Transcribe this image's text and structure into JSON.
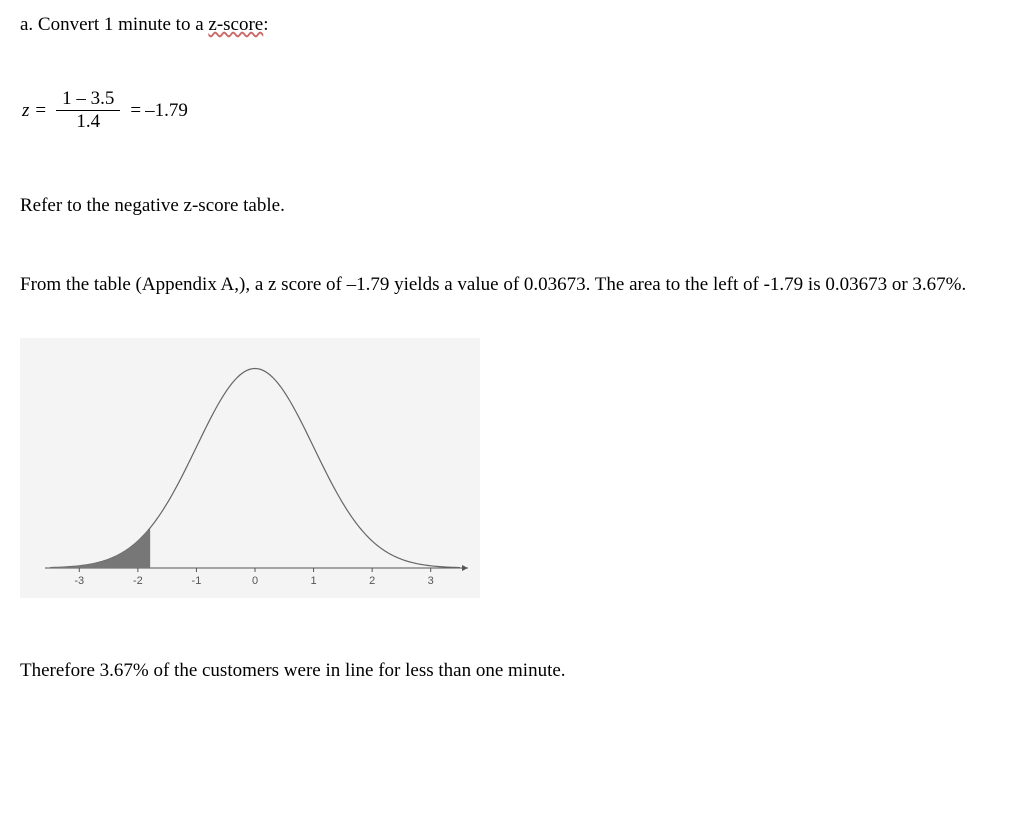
{
  "heading": {
    "prefix": "a. Convert 1 minute to a ",
    "underlined": "z-score",
    "suffix": ":"
  },
  "formula": {
    "var": "z",
    "eq1": "=",
    "numerator": "1 – 3.5",
    "denominator": "1.4",
    "eq2": "=",
    "result": "–1.79"
  },
  "para1": "Refer to the negative z-score table.",
  "para2": "From the table (Appendix A,), a z score of –1.79 yields a value of 0.03673.  The area to the left of -1.79 is   0.03673 or 3.67%.",
  "conclusion": "Therefore 3.67% of the customers were in line for less than one minute.",
  "chart_data": {
    "type": "area",
    "title": "",
    "xlabel": "",
    "ylabel": "",
    "xlim": [
      -3.5,
      3.5
    ],
    "ticks": [
      "-3",
      "-2",
      "-1",
      "0",
      "1",
      "2",
      "3"
    ],
    "distribution": "standard_normal",
    "shaded_region": {
      "from": -3.5,
      "to": -1.79,
      "area": 0.03673
    }
  }
}
